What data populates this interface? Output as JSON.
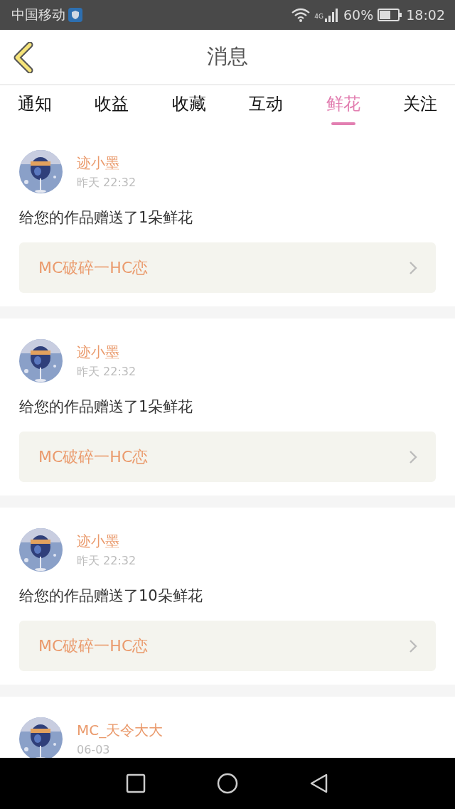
{
  "status_bar": {
    "carrier": "中国移动",
    "network": "4G",
    "battery": "60%",
    "time": "18:02"
  },
  "header": {
    "title": "消息"
  },
  "tabs": [
    {
      "label": "通知",
      "selected": false
    },
    {
      "label": "收益",
      "selected": false
    },
    {
      "label": "收藏",
      "selected": false
    },
    {
      "label": "互动",
      "selected": false
    },
    {
      "label": "鲜花",
      "selected": true
    },
    {
      "label": "关注",
      "selected": false
    }
  ],
  "messages": [
    {
      "name": "迹小墨",
      "time": "昨天 22:32",
      "text": "给您的作品赠送了1朵鲜花",
      "work": "MC破碎一HC恋"
    },
    {
      "name": "迹小墨",
      "time": "昨天 22:32",
      "text": "给您的作品赠送了1朵鲜花",
      "work": "MC破碎一HC恋"
    },
    {
      "name": "迹小墨",
      "time": "昨天 22:32",
      "text": "给您的作品赠送了10朵鲜花",
      "work": "MC破碎一HC恋"
    },
    {
      "name": "MC_天令大大",
      "time": "06-03"
    }
  ]
}
